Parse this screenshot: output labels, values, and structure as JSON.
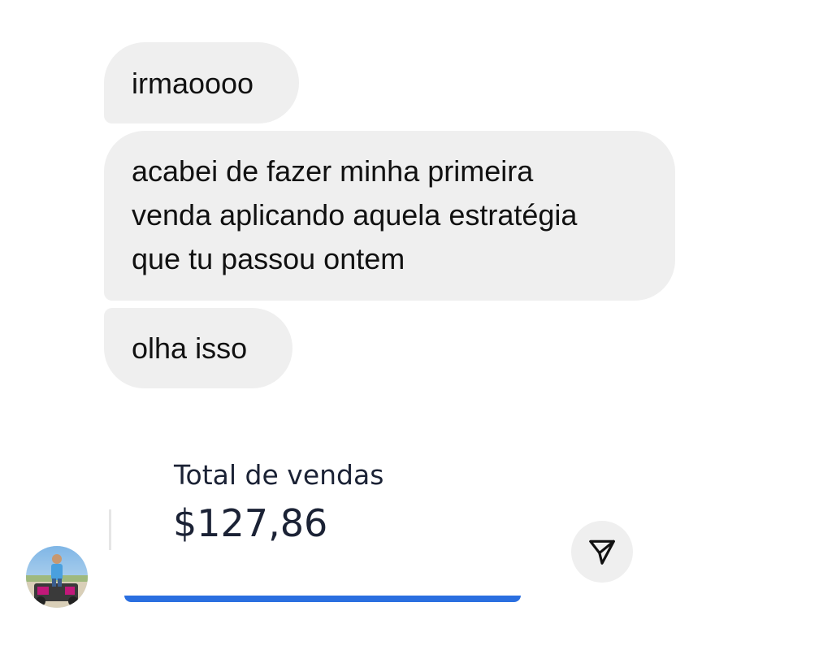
{
  "messages": [
    {
      "lines": [
        "irmaoooo"
      ]
    },
    {
      "lines": [
        "acabei de fazer minha primeira",
        "venda aplicando aquela estratégia",
        "que tu passou ontem"
      ]
    },
    {
      "lines": [
        "olha isso"
      ]
    }
  ],
  "shared_card": {
    "title": "Total de vendas",
    "value": "$127,86",
    "progress_fraction": 1.0,
    "accent_color": "#2a6fe0"
  },
  "actions": {
    "share_icon": "paper-plane-icon"
  },
  "bubble_color": "#efefef"
}
